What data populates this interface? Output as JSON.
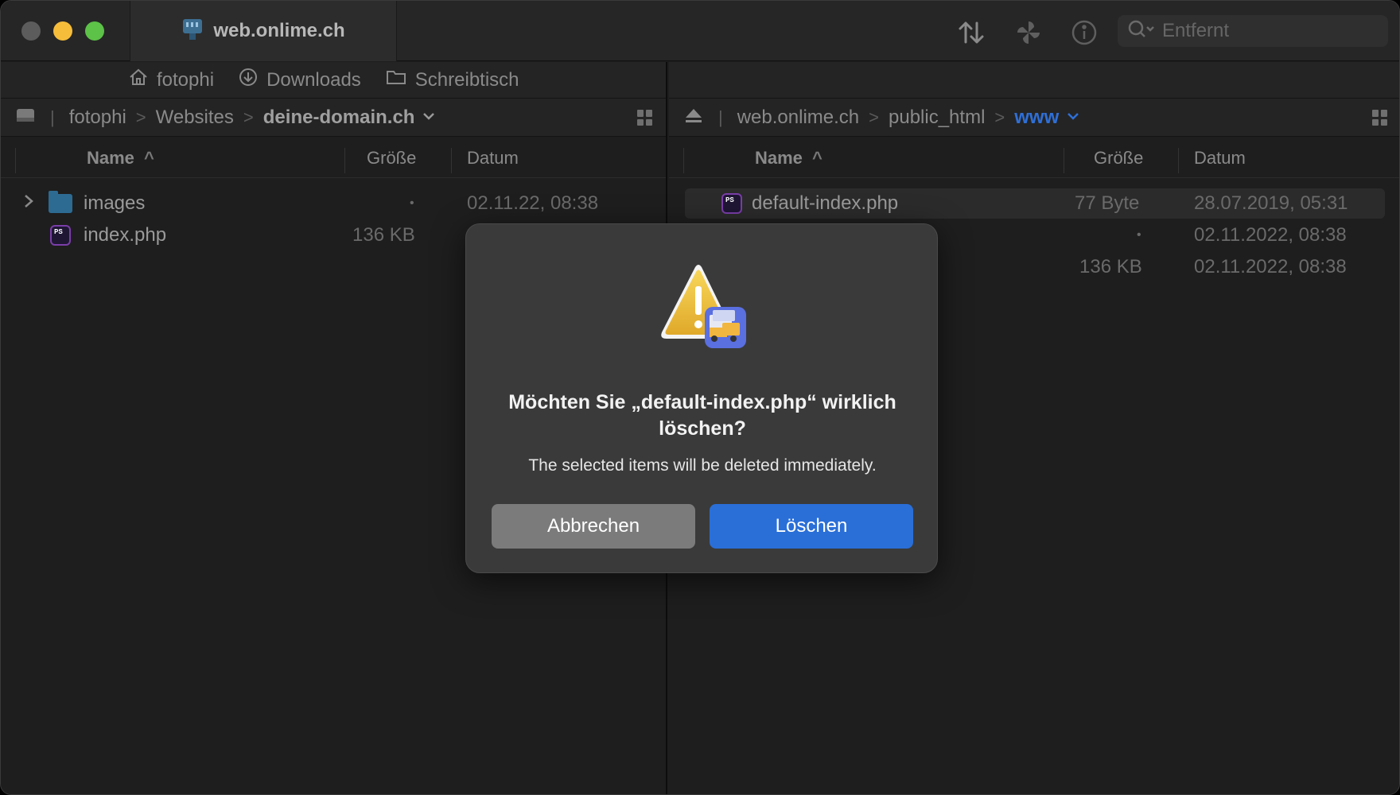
{
  "titlebar": {
    "tab_title": "web.onlime.ch",
    "search_placeholder": "Entfernt"
  },
  "left": {
    "favorites": [
      "fotophi",
      "Downloads",
      "Schreibtisch"
    ],
    "path": [
      "fotophi",
      "Websites"
    ],
    "path_current": "deine-domain.ch",
    "columns": {
      "name": "Name",
      "size": "Größe",
      "date": "Datum"
    },
    "rows": [
      {
        "name": "images",
        "size": "•",
        "date": "02.11.22, 08:38",
        "type": "folder"
      },
      {
        "name": "index.php",
        "size": "136 KB",
        "date": "",
        "type": "php"
      }
    ]
  },
  "right": {
    "path": [
      "web.onlime.ch",
      "public_html"
    ],
    "path_current": "www",
    "columns": {
      "name": "Name",
      "size": "Größe",
      "date": "Datum"
    },
    "rows": [
      {
        "name": "default-index.php",
        "size": "77 Byte",
        "date": "28.07.2019, 05:31",
        "type": "php"
      },
      {
        "name": "",
        "size": "•",
        "date": "02.11.2022, 08:38",
        "type": "hidden"
      },
      {
        "name": "",
        "size": "136 KB",
        "date": "02.11.2022, 08:38",
        "type": "hidden"
      }
    ]
  },
  "dialog": {
    "title": "Möchten Sie „default-index.php“ wirklich löschen?",
    "message": "The selected items will be deleted immediately.",
    "cancel_label": "Abbrechen",
    "confirm_label": "Löschen"
  },
  "colors": {
    "accent": "#2a6fd8",
    "warning": "#f0c33c"
  }
}
